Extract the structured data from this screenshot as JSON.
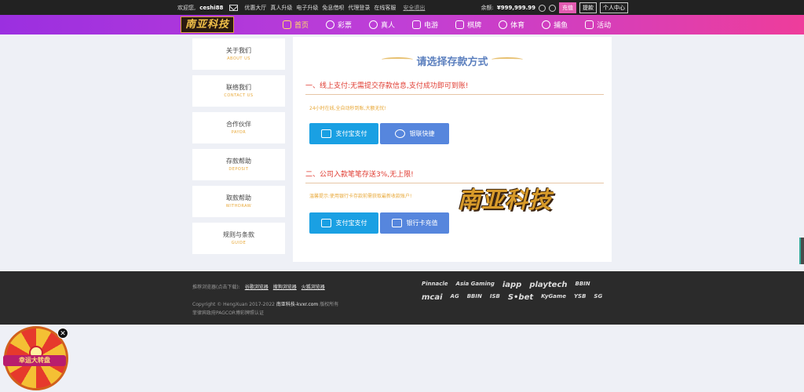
{
  "topbar": {
    "greeting": "欢迎您,",
    "username": "ceshi88",
    "links": [
      "优惠大厅",
      "真人升级",
      "电子升级",
      "免息借呗",
      "代理登录",
      "在线客服"
    ],
    "logout": "安全退出",
    "balance_label": "余额:",
    "balance": "¥999,999.99",
    "deposit": "充值",
    "withdraw": "提款",
    "profile": "个人中心"
  },
  "logo": "南亚科技",
  "nav": [
    {
      "label": "首页",
      "icon": "home-icon"
    },
    {
      "label": "彩票",
      "icon": "lottery-icon"
    },
    {
      "label": "真人",
      "icon": "live-icon"
    },
    {
      "label": "电游",
      "icon": "gamepad-icon"
    },
    {
      "label": "棋牌",
      "icon": "cards-icon"
    },
    {
      "label": "体育",
      "icon": "sports-icon"
    },
    {
      "label": "捕鱼",
      "icon": "fish-icon"
    },
    {
      "label": "活动",
      "icon": "gift-icon"
    }
  ],
  "sidebar": [
    {
      "cn": "关于我们",
      "en": "ABOUT US"
    },
    {
      "cn": "联络我们",
      "en": "CONTACT US"
    },
    {
      "cn": "合作伙伴",
      "en": "PAYOR"
    },
    {
      "cn": "存款帮助",
      "en": "DEPOSIT"
    },
    {
      "cn": "取款帮助",
      "en": "WITHDRAW"
    },
    {
      "cn": "规则与条款",
      "en": "GUIDE"
    }
  ],
  "panel": {
    "title": "请选择存款方式",
    "section1": "一、线上支付:无需提交存款信息,支付成功即可到账!",
    "tip1": "24小时在线,全自动秒到账,大额无忧!",
    "alipay1": "支付宝支付",
    "union": "银联快捷",
    "section2": "二、公司入款笔笔存送3%,无上限!",
    "tip2": "温馨提示:使用银行卡存款前需获取最新收款账户!",
    "alipay2": "支付宝支付",
    "bank": "银行卡充值",
    "watermark": "南亚科技"
  },
  "footer": {
    "line1_prefix": "推荐浏览器(点击下载):",
    "browsers": [
      "谷歌浏览器",
      "搜狗浏览器",
      "火狐浏览器"
    ],
    "copyright": "Copyright © HengXuan 2017-2022",
    "copyright_link": "南亚科技-kvxr.com",
    "rights": "版权所有",
    "license": "菲律宾政府PAGCOR博彩牌照认证",
    "partners": [
      "Pinnacle",
      "Asia Gaming",
      "iapp",
      "playtech",
      "BBIN",
      "mcai",
      "AG",
      "BBIN",
      "ISB",
      "S•bet",
      "KyGame",
      "YSB",
      "SG"
    ]
  },
  "promo": {
    "wheel_label": "幸运大转盘",
    "close": "✕"
  }
}
